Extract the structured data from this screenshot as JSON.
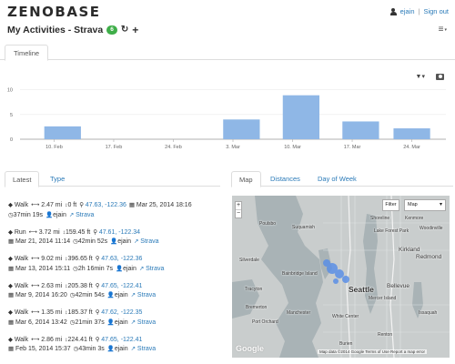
{
  "app": {
    "logo": "ZENOBASE"
  },
  "header": {
    "username": "ejain",
    "signout_label": "Sign out",
    "page_title": "My Activities - Strava",
    "count_badge": "6"
  },
  "timeline": {
    "tab_label": "Timeline"
  },
  "chart_data": {
    "type": "bar",
    "categories": [
      "10. Feb",
      "17. Feb",
      "24. Feb",
      "3. Mar",
      "10. Mar",
      "17. Mar",
      "24. Mar"
    ],
    "bars": [
      {
        "x": 1,
        "value": 2.6
      },
      {
        "x": 22,
        "value": 4.0
      },
      {
        "x": 29,
        "value": 8.9
      },
      {
        "x": 36,
        "value": 3.6
      },
      {
        "x": 42,
        "value": 2.2
      }
    ],
    "yticks": [
      0,
      5,
      10
    ],
    "ylim": [
      0,
      10.5
    ],
    "xlim": [
      -4,
      46
    ],
    "bar_color": "#8fb7e6",
    "grid": true
  },
  "left_tabs": {
    "latest": "Latest",
    "type": "Type"
  },
  "activities": [
    {
      "type": "Walk",
      "distance": "2.47 mi",
      "elevation": "0 ft",
      "location": "47.63, -122.36",
      "date": "Mar 25, 2014 18:16",
      "duration": "37min 19s",
      "user": "ejain",
      "link": "Strava",
      "order": "dist-elev-loc-date-dur"
    },
    {
      "type": "Run",
      "distance": "3.72 mi",
      "elevation": "159.45 ft",
      "location": "47.61, -122.34",
      "date": "Mar 21, 2014 11:14",
      "duration": "42min 52s",
      "user": "ejain",
      "link": "Strava",
      "order": "dist-elev-loc / date-dur"
    },
    {
      "type": "Walk",
      "distance": "9.02 mi",
      "elevation": "396.65 ft",
      "location": "47.63, -122.36",
      "date": "Mar 13, 2014 15:11",
      "duration": "2h 16min 7s",
      "user": "ejain",
      "link": "Strava",
      "order": "dist-elev-loc / date-dur"
    },
    {
      "type": "Walk",
      "distance": "2.63 mi",
      "elevation": "205.38 ft",
      "location": "47.65, -122.41",
      "date": "Mar 9, 2014 16:20",
      "duration": "42min 54s",
      "user": "ejain",
      "link": "Strava",
      "order": "dist-elev-loc / date-dur"
    },
    {
      "type": "Walk",
      "distance": "1.35 mi",
      "elevation": "185.37 ft",
      "location": "47.62, -122.35",
      "date": "Mar 6, 2014 13:42",
      "duration": "21min 37s",
      "user": "ejain",
      "link": "Strava",
      "order": "dist-elev-loc / date-dur"
    },
    {
      "type": "Walk",
      "distance": "2.86 mi",
      "elevation": "224.41 ft",
      "location": "47.65, -122.41",
      "date": "Feb 15, 2014 15:37",
      "duration": "43min 3s",
      "user": "ejain",
      "link": "Strava",
      "order": "dist-elev-loc / date-dur"
    }
  ],
  "right_tabs": {
    "map": "Map",
    "distances": "Distances",
    "day_of_week": "Day of Week"
  },
  "map": {
    "filter_label": "Filter",
    "type_label": "Map",
    "zoom_in": "+",
    "zoom_out": "−",
    "credit": "Map data ©2014 Google   Terms of Use   Report a map error",
    "google": "Google",
    "labels": {
      "shoreline": "Shoreline",
      "kenmore": "Kenmore",
      "woodinville": "Woodinville",
      "suquamish": "Suquamish",
      "poulsbo": "Poulsbo",
      "kirkland": "Kirkland",
      "redmond": "Redmond",
      "bainbridge": "Bainbridge Island",
      "seattle": "Seattle",
      "bellevue": "Bellevue",
      "bremerton": "Bremerton",
      "manchester": "Manchester",
      "port_orchard": "Port Orchard",
      "renton": "Renton",
      "white_center": "White Center",
      "burien": "Burien",
      "mercer": "Mercer Island",
      "issaquah": "Issaquah",
      "lake_forest": "Lake Forest Park",
      "silverdale": "Silverdale",
      "tracyton": "Tracyton"
    }
  }
}
